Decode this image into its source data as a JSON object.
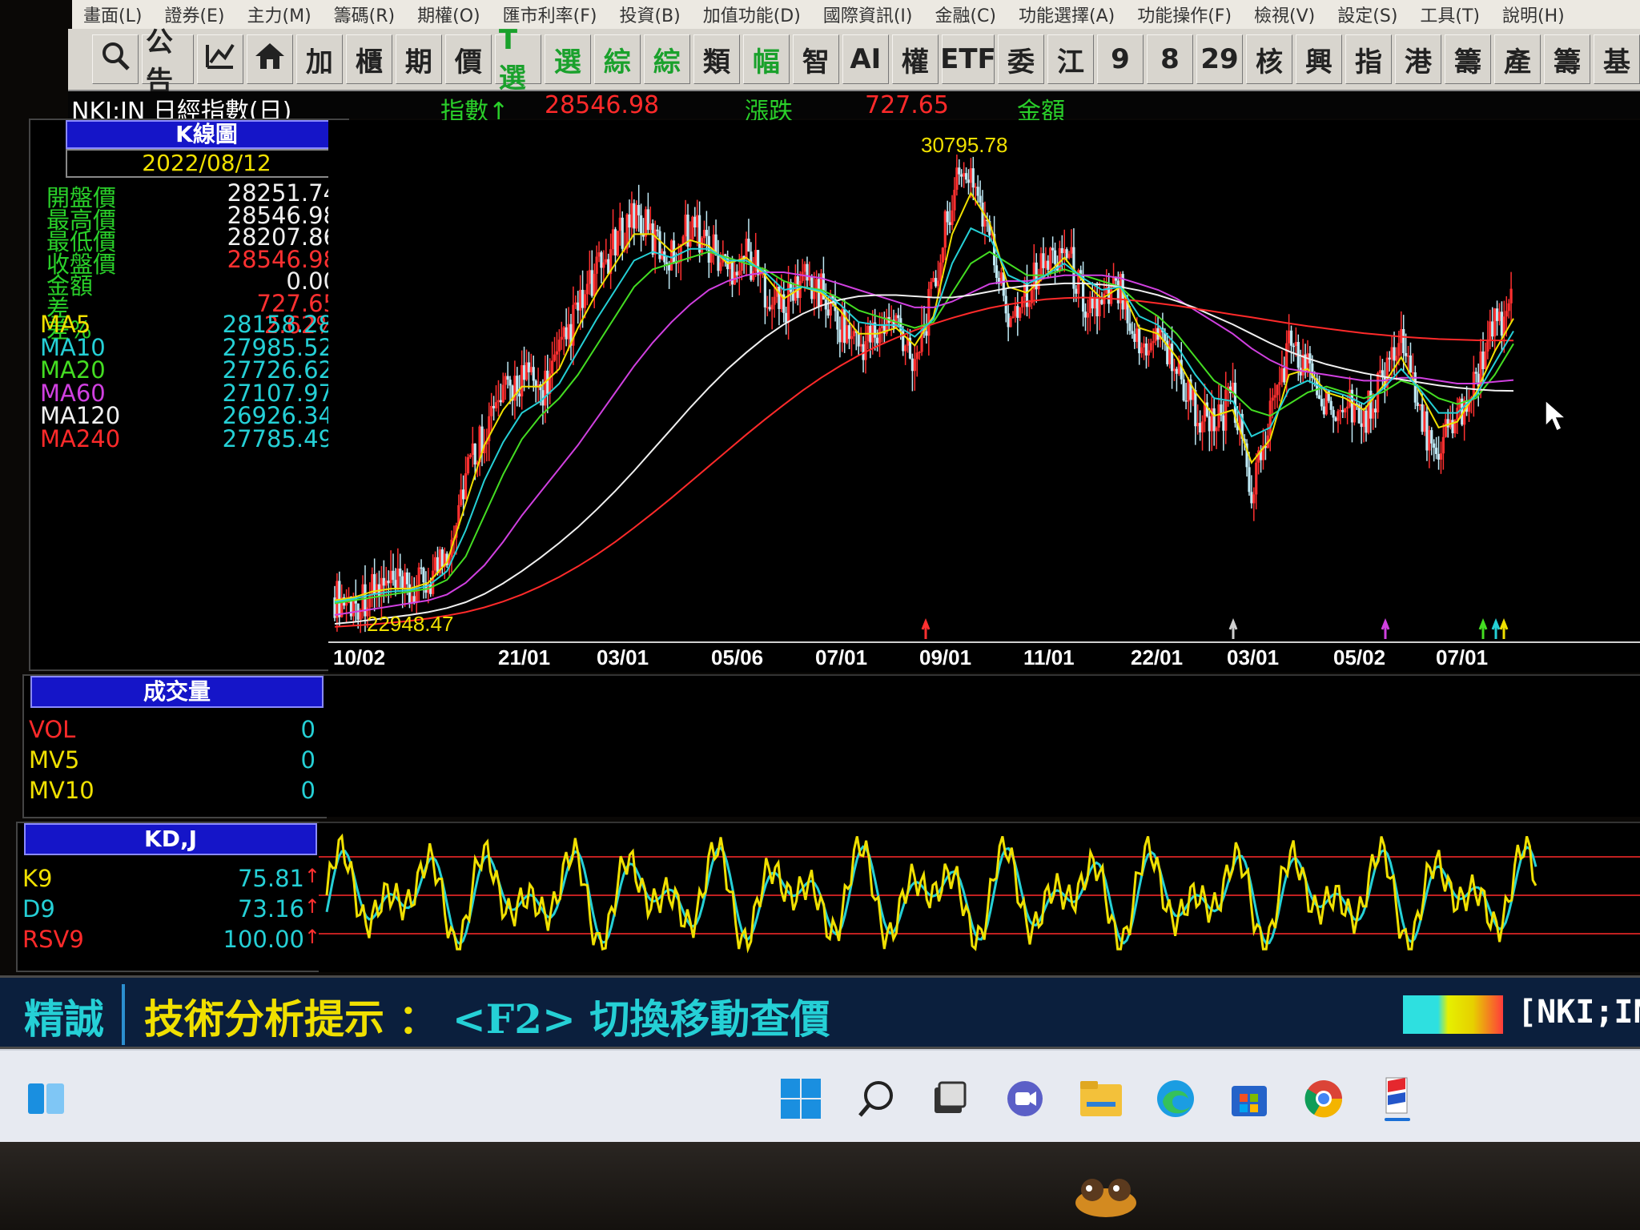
{
  "menu": [
    "畫面(L)",
    "證券(E)",
    "主力(M)",
    "籌碼(R)",
    "期權(O)",
    "匯市利率(F)",
    "投資(B)",
    "加值功能(D)",
    "國際資訊(I)",
    "金融(C)",
    "功能選擇(A)",
    "功能操作(F)",
    "檢視(V)",
    "設定(S)",
    "工具(T)",
    "說明(H)"
  ],
  "toolbar": [
    {
      "label": "",
      "icon": "search-icon"
    },
    {
      "label": "公告"
    },
    {
      "label": "",
      "icon": "chart-edit-icon"
    },
    {
      "label": "",
      "icon": "home-icon"
    },
    {
      "label": "加"
    },
    {
      "label": "櫃"
    },
    {
      "label": "期"
    },
    {
      "label": "價"
    },
    {
      "label": "T選",
      "green": true
    },
    {
      "label": "選",
      "green": true
    },
    {
      "label": "綜",
      "green": true
    },
    {
      "label": "綜",
      "green": true
    },
    {
      "label": "類"
    },
    {
      "label": "幅",
      "green": true
    },
    {
      "label": "智"
    },
    {
      "label": "AI"
    },
    {
      "label": "權"
    },
    {
      "label": "ETF"
    },
    {
      "label": "委"
    },
    {
      "label": "江"
    },
    {
      "label": "9"
    },
    {
      "label": "8"
    },
    {
      "label": "29"
    },
    {
      "label": "核"
    },
    {
      "label": "興"
    },
    {
      "label": "指"
    },
    {
      "label": "港"
    },
    {
      "label": "籌"
    },
    {
      "label": "產"
    },
    {
      "label": "籌"
    },
    {
      "label": "基"
    }
  ],
  "info": {
    "symbol": "NKI;IN 日經指數(日)",
    "index_label": "指數↑",
    "index_value": "28546.98",
    "change_label": "漲跌",
    "change_value": "727.65",
    "amount_label": "金額"
  },
  "kpanel": {
    "title": "K線圖",
    "date": "2022/08/12",
    "rows": [
      {
        "label": "開盤價",
        "value": "28251.74"
      },
      {
        "label": "最高價",
        "value": "28546.98"
      },
      {
        "label": "最低價",
        "value": "28207.86"
      },
      {
        "label": "收盤價",
        "value": "28546.98"
      },
      {
        "label": "金額",
        "value": "0.00"
      },
      {
        "label": "差",
        "value": "727.65"
      },
      {
        "label": "差%",
        "value": "2.62%"
      }
    ],
    "ma": [
      {
        "label": "MA5",
        "value": "28158.28",
        "color": "#f0e000"
      },
      {
        "label": "MA10",
        "value": "27985.52",
        "color": "#25d0d6"
      },
      {
        "label": "MA20",
        "value": "27726.62",
        "color": "#44dd22"
      },
      {
        "label": "MA60",
        "value": "27107.97",
        "color": "#d040e0"
      },
      {
        "label": "MA120",
        "value": "26926.34",
        "color": "#f0f0f0"
      },
      {
        "label": "MA240",
        "value": "27785.49",
        "color": "#ff2a2a"
      }
    ]
  },
  "volpanel": {
    "title": "成交量",
    "rows": [
      {
        "label": "VOL",
        "value": "0",
        "color": "#ff2a2a"
      },
      {
        "label": "MV5",
        "value": "0",
        "color": "#f0e000"
      },
      {
        "label": "MV10",
        "value": "0",
        "color": "#f0e000"
      }
    ]
  },
  "kdpanel": {
    "title": "KD,J",
    "rows": [
      {
        "label": "K9",
        "value": "75.81",
        "color": "#f0e000"
      },
      {
        "label": "D9",
        "value": "73.16",
        "color": "#25d0d6"
      },
      {
        "label": "RSV9",
        "value": "100.00",
        "color": "#ff2a2a"
      }
    ]
  },
  "chart_data": {
    "type": "candlestick",
    "high_label": "30795.78",
    "low_label": "22948.47",
    "x_ticks": [
      "10/02",
      "21/01",
      "03/01",
      "05/06",
      "07/01",
      "09/01",
      "11/01",
      "22/01",
      "03/01",
      "05/02",
      "07/01"
    ],
    "close_path": [
      23400,
      23300,
      23500,
      23600,
      23450,
      23700,
      24200,
      25500,
      26300,
      26800,
      27200,
      26900,
      27500,
      28300,
      28900,
      29400,
      30000,
      29500,
      29200,
      29800,
      29400,
      29000,
      29300,
      28700,
      28300,
      28900,
      28600,
      28100,
      27700,
      27900,
      28100,
      27500,
      28600,
      30300,
      30700,
      29500,
      28200,
      28700,
      29100,
      29400,
      28500,
      28300,
      28800,
      27600,
      28000,
      27300,
      26600,
      26300,
      26800,
      25200,
      26500,
      27700,
      27300,
      26600,
      26900,
      26400,
      27200,
      27800,
      26400,
      26000,
      26500,
      27200,
      28000,
      28550
    ],
    "ma_lines": {
      "MA5": [
        23350,
        23400,
        23500,
        23550,
        23550,
        23650,
        24000,
        25000,
        26000,
        26600,
        27000,
        27000,
        27300,
        28000,
        28600,
        29100,
        29600,
        29600,
        29300,
        29500,
        29400,
        29100,
        29200,
        28900,
        28500,
        28700,
        28600,
        28300,
        27900,
        27900,
        28000,
        27700,
        28200,
        29600,
        30300,
        29800,
        28700,
        28600,
        28900,
        29200,
        28800,
        28500,
        28700,
        28000,
        27900,
        27500,
        26900,
        26500,
        26600,
        25700,
        26100,
        27200,
        27300,
        26900,
        26800,
        26600,
        27000,
        27500,
        26900,
        26300,
        26400,
        26900,
        27600,
        28160
      ],
      "MA20": [
        23300,
        23350,
        23400,
        23450,
        23500,
        23550,
        23700,
        24100,
        24800,
        25500,
        26100,
        26500,
        26800,
        27200,
        27700,
        28200,
        28700,
        29000,
        29100,
        29200,
        29300,
        29200,
        29100,
        29000,
        28800,
        28700,
        28650,
        28500,
        28300,
        28200,
        28100,
        28000,
        28100,
        28600,
        29100,
        29300,
        29100,
        28900,
        28900,
        29000,
        28900,
        28800,
        28700,
        28400,
        28200,
        27900,
        27500,
        27100,
        26900,
        26600,
        26500,
        26700,
        26900,
        27000,
        26900,
        26800,
        26900,
        27100,
        27000,
        26800,
        26700,
        26800,
        27200,
        27730
      ],
      "MA60": [
        23100,
        23150,
        23200,
        23250,
        23300,
        23350,
        23450,
        23650,
        23950,
        24350,
        24800,
        25200,
        25600,
        26000,
        26450,
        26900,
        27350,
        27750,
        28100,
        28400,
        28650,
        28800,
        28900,
        28950,
        28950,
        28900,
        28850,
        28750,
        28650,
        28550,
        28450,
        28350,
        28350,
        28450,
        28600,
        28750,
        28800,
        28800,
        28850,
        28900,
        28900,
        28900,
        28850,
        28750,
        28650,
        28500,
        28300,
        28100,
        27900,
        27650,
        27450,
        27300,
        27250,
        27200,
        27150,
        27100,
        27100,
        27150,
        27150,
        27100,
        27050,
        27050,
        27080,
        27110
      ],
      "MA120": [
        22950,
        22980,
        23020,
        23060,
        23100,
        23150,
        23220,
        23320,
        23460,
        23640,
        23850,
        24080,
        24330,
        24600,
        24900,
        25220,
        25560,
        25920,
        26280,
        26640,
        26980,
        27300,
        27580,
        27840,
        28060,
        28240,
        28380,
        28480,
        28540,
        28560,
        28560,
        28540,
        28520,
        28520,
        28560,
        28620,
        28680,
        28720,
        28740,
        28760,
        28760,
        28740,
        28700,
        28640,
        28560,
        28460,
        28340,
        28200,
        28060,
        27900,
        27740,
        27600,
        27480,
        27380,
        27300,
        27230,
        27170,
        27120,
        27070,
        27020,
        26980,
        26950,
        26930,
        26926
      ],
      "MA240": [
        22900,
        22920,
        22940,
        22970,
        23000,
        23040,
        23090,
        23150,
        23230,
        23330,
        23450,
        23590,
        23750,
        23930,
        24130,
        24350,
        24590,
        24840,
        25100,
        25370,
        25640,
        25910,
        26180,
        26440,
        26690,
        26930,
        27150,
        27350,
        27530,
        27690,
        27830,
        27960,
        28070,
        28170,
        28260,
        28340,
        28400,
        28450,
        28490,
        28510,
        28520,
        28510,
        28490,
        28460,
        28420,
        28380,
        28330,
        28280,
        28230,
        28180,
        28130,
        28080,
        28030,
        27990,
        27950,
        27910,
        27880,
        27850,
        27830,
        27810,
        27800,
        27790,
        27787,
        27785
      ]
    },
    "y_range": [
      22800,
      31000
    ],
    "kd_range": [
      0,
      100
    ],
    "kd_ref_lines": [
      80,
      50,
      20
    ]
  },
  "tips": {
    "brand": "精誠",
    "text": "技術分析提示 ：",
    "key": "<F2>",
    "text2": "切換移動查價",
    "symbol": "[NKI;IN"
  },
  "taskbar_icons": [
    "windows-start-icon",
    "search-icon",
    "task-view-icon",
    "chat-icon",
    "file-explorer-icon",
    "edge-icon",
    "store-icon",
    "chrome-icon",
    "trading-app-icon"
  ]
}
